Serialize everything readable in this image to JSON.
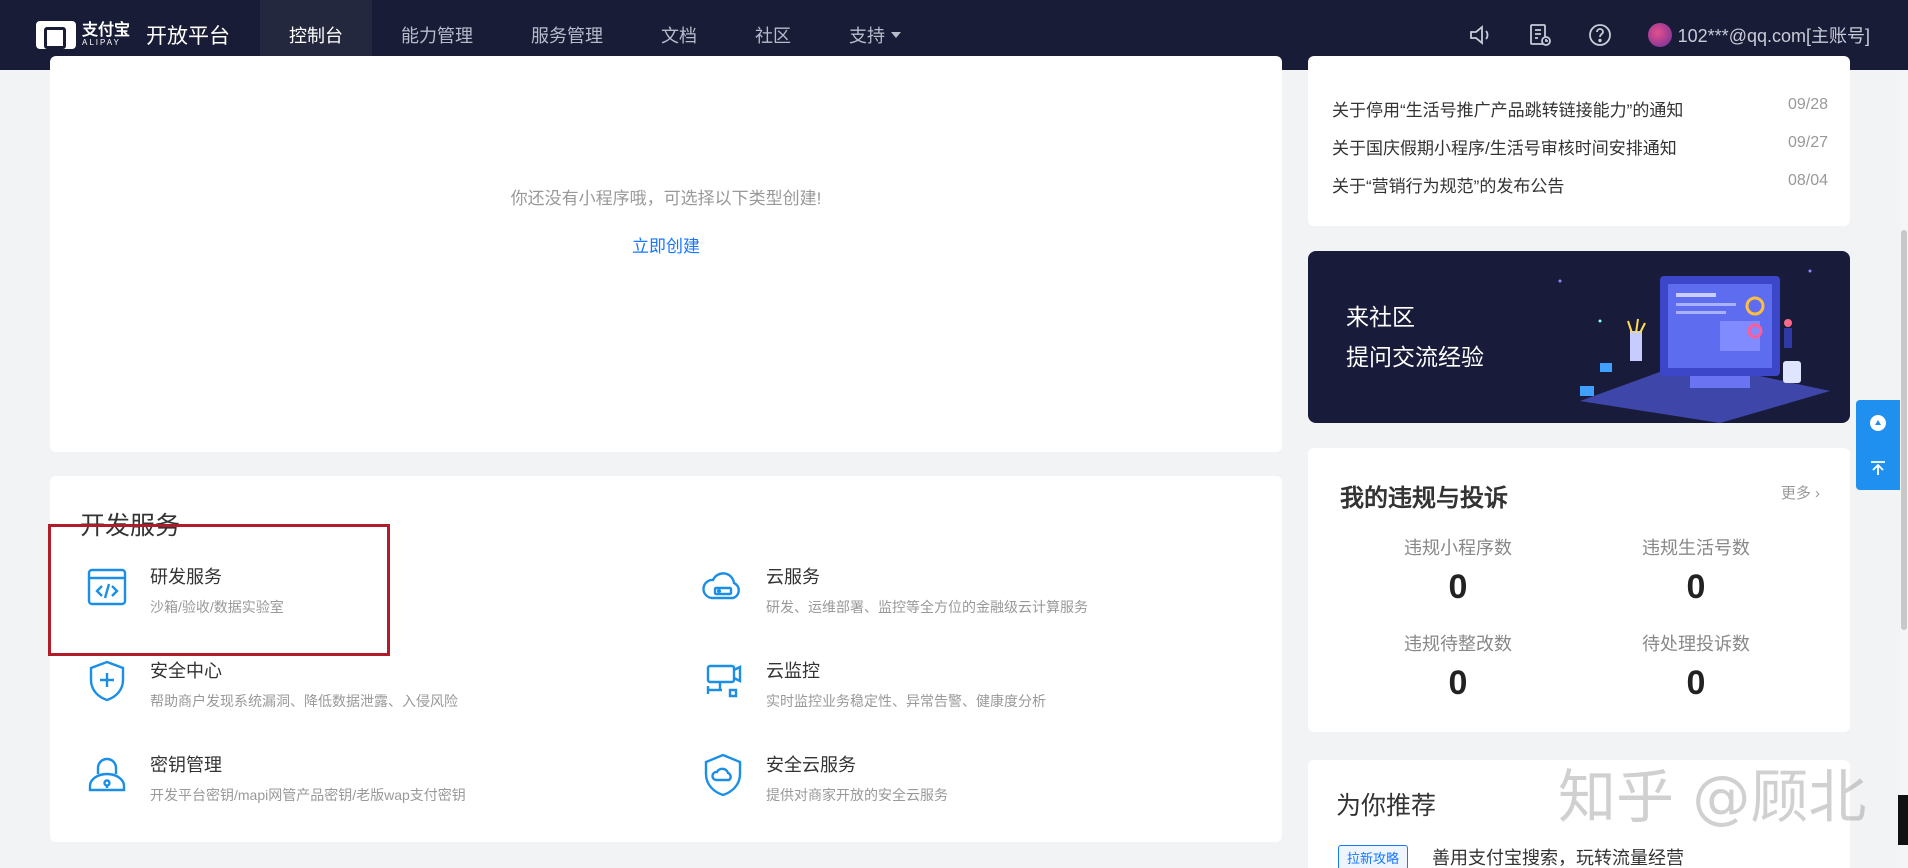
{
  "nav": {
    "logo_cn": "支付宝",
    "logo_en": "ALIPAY",
    "title": "开放平台",
    "items": [
      {
        "label": "控制台",
        "active": true
      },
      {
        "label": "能力管理"
      },
      {
        "label": "服务管理"
      },
      {
        "label": "文档"
      },
      {
        "label": "社区"
      },
      {
        "label": "支持"
      }
    ],
    "icons": [
      "speaker-icon",
      "document-clock-icon",
      "help-icon"
    ],
    "user": "102***@qq.com[主账号]"
  },
  "miniapp": {
    "empty_text": "你还没有小程序哦，可选择以下类型创建!",
    "create_link": "立即创建"
  },
  "dev_services": {
    "title": "开发服务",
    "items": [
      {
        "name": "研发服务",
        "desc": "沙箱/验收/数据实验室",
        "icon": "code-window-icon"
      },
      {
        "name": "云服务",
        "desc": "研发、运维部署、监控等全方位的金融级云计算服务",
        "icon": "cloud-server-icon"
      },
      {
        "name": "安全中心",
        "desc": "帮助商户发现系统漏洞、降低数据泄露、入侵风险",
        "icon": "shield-plus-icon"
      },
      {
        "name": "云监控",
        "desc": "实时监控业务稳定性、异常告警、健康度分析",
        "icon": "camera-monitor-icon"
      },
      {
        "name": "密钥管理",
        "desc": "开发平台密钥/mapi网管产品密钥/老版wap支付密钥",
        "icon": "lock-icon"
      },
      {
        "name": "安全云服务",
        "desc": "提供对商家开放的安全云服务",
        "icon": "shield-cloud-icon"
      }
    ]
  },
  "notices": [
    {
      "title": "关于停用“生活号推广产品跳转链接能力”的通知",
      "date": "09/28"
    },
    {
      "title": "关于国庆假期小程序/生活号审核时间安排通知",
      "date": "09/27"
    },
    {
      "title": "关于“营销行为规范”的发布公告",
      "date": "08/04"
    }
  ],
  "community": {
    "line1": "来社区",
    "line2": "提问交流经验"
  },
  "violations": {
    "title": "我的违规与投诉",
    "more": "更多",
    "stats": [
      {
        "label": "违规小程序数",
        "value": "0"
      },
      {
        "label": "违规生活号数",
        "value": "0"
      },
      {
        "label": "违规待整改数",
        "value": "0"
      },
      {
        "label": "待处理投诉数",
        "value": "0"
      }
    ]
  },
  "recommend": {
    "title": "为你推荐",
    "badge": "拉新攻略",
    "text": "善用支付宝搜索，玩转流量经营"
  },
  "watermark": "知乎 @顾北",
  "colors": {
    "nav_bg": "#191c36",
    "accent": "#1677ff",
    "icon_blue": "#1b8fe6",
    "highlight": "#b01c2a"
  }
}
